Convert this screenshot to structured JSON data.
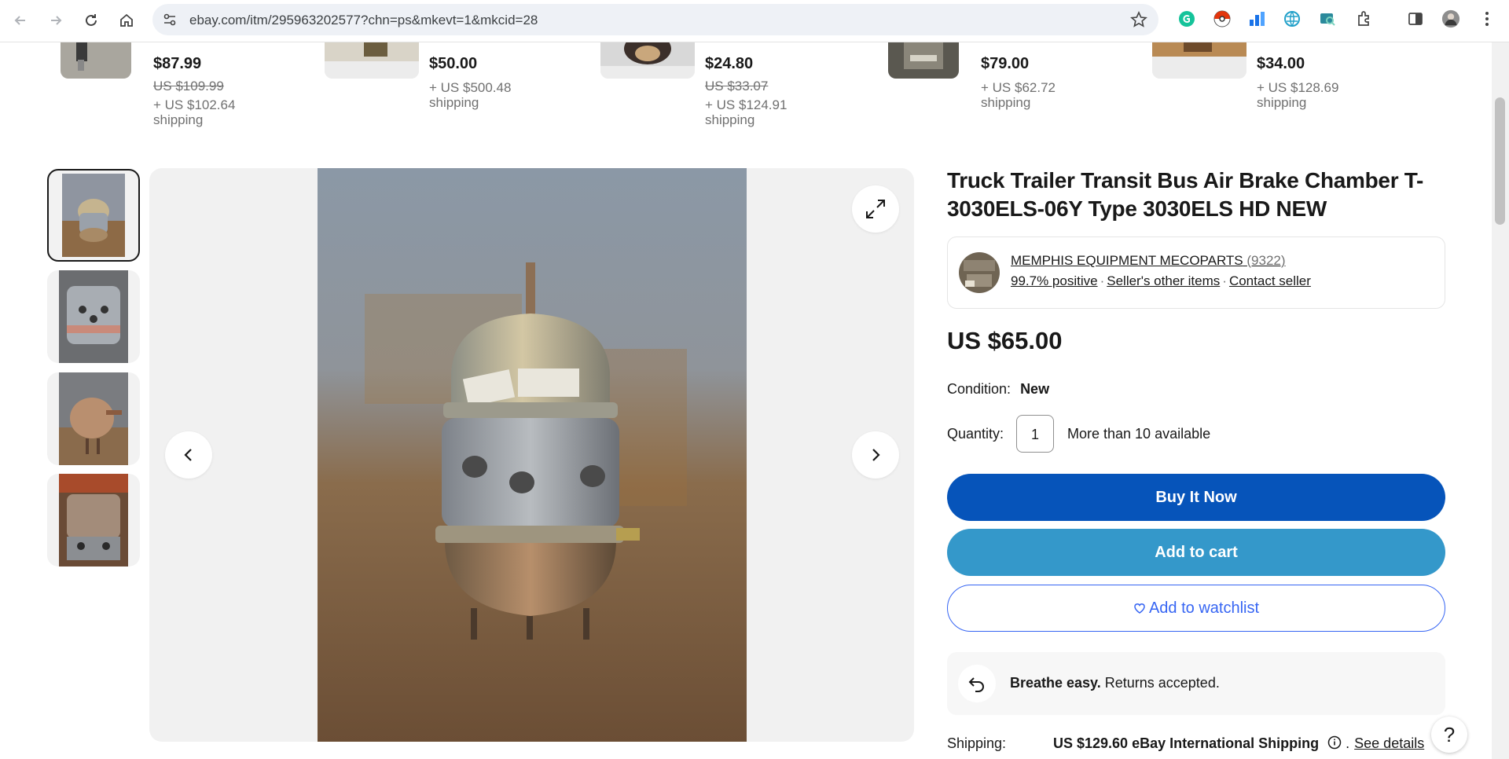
{
  "browser": {
    "url": "ebay.com/itm/295963202577?chn=ps&mkevt=1&mkcid=28"
  },
  "similar_items": [
    {
      "price": "$87.99",
      "original": "US $109.99",
      "shipping": "+ US $102.64 shipping"
    },
    {
      "price": "$50.00",
      "original": "",
      "shipping": "+ US $500.48 shipping"
    },
    {
      "price": "$24.80",
      "original": "US $33.07",
      "shipping": "+ US $124.91 shipping"
    },
    {
      "price": "$79.00",
      "original": "",
      "shipping": "+ US $62.72 shipping"
    },
    {
      "price": "$34.00",
      "original": "",
      "shipping": "+ US $128.69 shipping"
    }
  ],
  "listing": {
    "title": "Truck Trailer Transit Bus Air Brake Chamber T-3030ELS-06Y Type 3030ELS HD NEW",
    "seller": {
      "name": "MEMPHIS EQUIPMENT MECOPARTS",
      "count": "(9322)",
      "positive": "99.7% positive",
      "other_items": "Seller's other items",
      "contact": "Contact seller",
      "separator": "·"
    },
    "price": "US $65.00",
    "condition_label": "Condition:",
    "condition_value": "New",
    "quantity_label": "Quantity:",
    "quantity_value": "1",
    "availability": "More than 10 available",
    "buy_now": "Buy It Now",
    "add_to_cart": "Add to cart",
    "add_to_watchlist": "Add to watchlist",
    "returns_bold": "Breathe easy.",
    "returns_text": "Returns accepted.",
    "shipping_label": "Shipping:",
    "shipping_value": "US $129.60 eBay International Shipping",
    "see_details": "See details",
    "help": "?"
  },
  "colors": {
    "buy_now": "#0654ba",
    "add_to_cart": "#3498ca",
    "watchlist": "#3665f3"
  }
}
